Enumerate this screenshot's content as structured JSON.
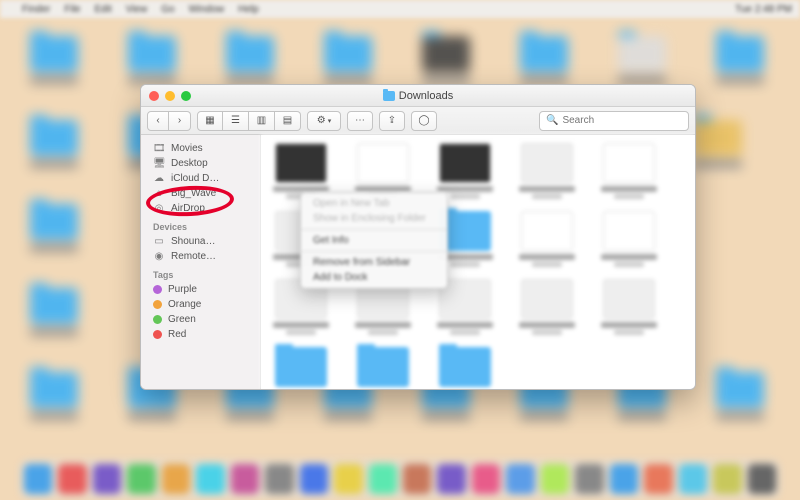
{
  "menubar": {
    "app": "Finder",
    "items": [
      "File",
      "Edit",
      "View",
      "Go",
      "Window",
      "Help"
    ],
    "time": "Tue 2:48 PM"
  },
  "window": {
    "title": "Downloads",
    "toolbar": {
      "back": "‹",
      "forward": "›",
      "search_placeholder": "Search"
    }
  },
  "sidebar": {
    "favorites": [
      {
        "icon": "film-icon",
        "glyph": "🎞",
        "label": "Movies"
      },
      {
        "icon": "desktop-icon",
        "glyph": "🖥",
        "label": "Desktop"
      },
      {
        "icon": "cloud-icon",
        "glyph": "☁",
        "label": "iCloud D…"
      },
      {
        "icon": "home-icon",
        "glyph": "⌂",
        "label": "Big_Wave"
      },
      {
        "icon": "airdrop-icon",
        "glyph": "◎",
        "label": "AirDrop"
      }
    ],
    "devices_heading": "Devices",
    "devices": [
      {
        "icon": "laptop-icon",
        "glyph": "▭",
        "label": "Shouna…"
      },
      {
        "icon": "disc-icon",
        "glyph": "◉",
        "label": "Remote…"
      }
    ],
    "tags_heading": "Tags",
    "tags": [
      {
        "color": "#b565d8",
        "label": "Purple"
      },
      {
        "color": "#f2a33c",
        "label": "Orange"
      },
      {
        "color": "#63c657",
        "label": "Green"
      },
      {
        "color": "#ef5350",
        "label": "Red"
      }
    ]
  },
  "context_menu": {
    "items": [
      {
        "label": "Open in New Tab",
        "disabled": true
      },
      {
        "label": "Show in Enclosing Folder",
        "disabled": true
      },
      {
        "sep": true
      },
      {
        "label": "Get Info",
        "disabled": false
      },
      {
        "sep": true
      },
      {
        "label": "Remove from Sidebar",
        "disabled": false
      },
      {
        "label": "Add to Dock",
        "disabled": false
      }
    ]
  },
  "annotation": {
    "target": "Big_Wave sidebar item circled in red"
  }
}
